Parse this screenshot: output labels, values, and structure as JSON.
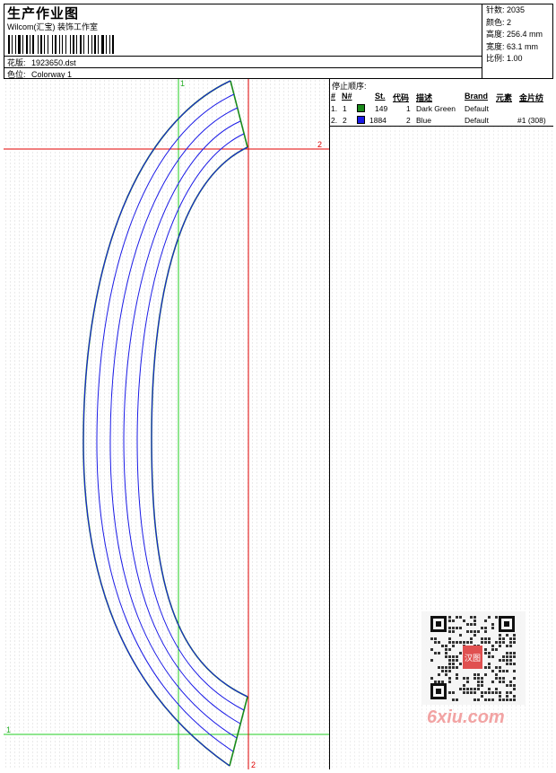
{
  "header": {
    "title": "生产作业图",
    "subtitle": "Wilcom(汇宝) 装饰工作室",
    "design_label": "花版:",
    "design_file": "1923650.dst",
    "colorway_label": "色位:",
    "colorway": "Colorway 1"
  },
  "info": [
    {
      "label": "针数:",
      "value": "2035"
    },
    {
      "label": "颜色:",
      "value": "2"
    },
    {
      "label": "高度:",
      "value": "256.4 mm"
    },
    {
      "label": "宽度:",
      "value": "63.1 mm"
    },
    {
      "label": "比例:",
      "value": "1.00"
    }
  ],
  "stop_sequence": {
    "title": "停止顺序:",
    "columns": [
      "#",
      "N#",
      "St.",
      "代码",
      "描述",
      "Brand",
      "元素",
      "金片纺"
    ],
    "rows": [
      {
        "num": "1.",
        "n": "1",
        "color": "#1a8a1a",
        "stitches": "149",
        "code": "1",
        "desc": "Dark Green",
        "brand": "Default",
        "element": "",
        "sequin": ""
      },
      {
        "num": "2.",
        "n": "2",
        "color": "#1a1ae6",
        "stitches": "1884",
        "code": "2",
        "desc": "Blue",
        "brand": "Default",
        "element": "#1 (308)",
        "sequin": ""
      }
    ]
  },
  "markers": {
    "green_top": "1",
    "green_left": "1",
    "red_right": "2",
    "red_bottom": "2"
  },
  "colors": {
    "thread_green": "#1a8a1a",
    "thread_blue": "#1a1ae6",
    "guide_green": "#22cc22",
    "guide_red": "#e00000"
  },
  "watermark": {
    "stamp": "汉图",
    "site": "6xiu.com"
  }
}
